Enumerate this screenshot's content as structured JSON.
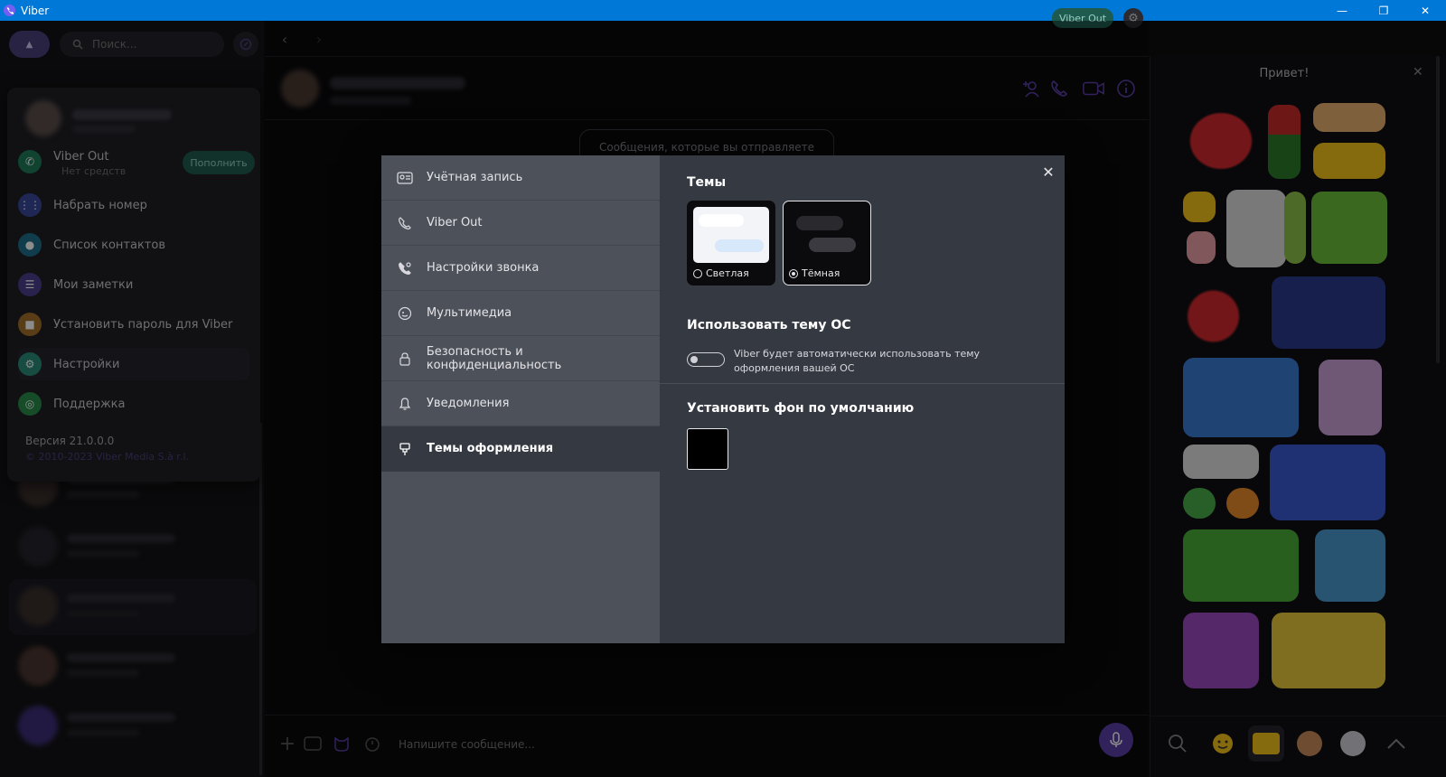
{
  "window": {
    "title": "Viber",
    "controls": [
      "—",
      "❐",
      "✕"
    ]
  },
  "left_panel": {
    "search": {
      "placeholder": "Поиск..."
    },
    "menu": {
      "viber_out": {
        "label": "Viber Out",
        "subtitle": "Нет средств",
        "topup_label": "Пополнить"
      },
      "items": [
        {
          "label": "Набрать номер",
          "icon": "dialpad-icon",
          "color": "#3a4a9a"
        },
        {
          "label": "Список контактов",
          "icon": "contacts-icon",
          "color": "#1f6e8a"
        },
        {
          "label": "Мои заметки",
          "icon": "notes-icon",
          "color": "#4a3f8a"
        },
        {
          "label": "Установить пароль для Viber",
          "icon": "lock-icon",
          "color": "#a0702a"
        },
        {
          "label": "Настройки",
          "icon": "gear-icon",
          "color": "#2a8a7a"
        },
        {
          "label": "Поддержка",
          "icon": "support-icon",
          "color": "#2a8a4a"
        }
      ],
      "version": "Версия 21.0.0.0",
      "copyright": "© 2010-2023 Viber Media S.à r.l."
    }
  },
  "top_bar": {
    "viber_out_label": "Viber Out"
  },
  "chat": {
    "encryption_notice": "Сообщения, которые вы отправляете",
    "composer_placeholder": "Напишите сообщение..."
  },
  "sticker_panel": {
    "greeting": "Привет!"
  },
  "settings_dialog": {
    "sidebar": [
      {
        "label": "Учётная запись",
        "icon": "account-card-icon",
        "active": false
      },
      {
        "label": "Viber Out",
        "icon": "phone-out-icon",
        "active": false
      },
      {
        "label": "Настройки звонка",
        "icon": "call-settings-icon",
        "active": false
      },
      {
        "label": "Мультимедиа",
        "icon": "media-icon",
        "active": false
      },
      {
        "label": "Безопасность и конфиденциальность",
        "icon": "lock-icon",
        "active": false
      },
      {
        "label": "Уведомления",
        "icon": "bell-icon",
        "active": false
      },
      {
        "label": "Темы оформления",
        "icon": "brush-icon",
        "active": true
      }
    ],
    "themes_heading": "Темы",
    "themes": [
      {
        "label": "Светлая",
        "selected": false
      },
      {
        "label": "Тёмная",
        "selected": true
      }
    ],
    "os_theme_heading": "Использовать тему ОС",
    "os_theme_description": "Viber будет автоматически использовать тему оформления вашей ОС",
    "os_theme_enabled": false,
    "default_bg_heading": "Установить фон по умолчанию",
    "default_bg_color": "#000000"
  },
  "colors": {
    "accent": "#5b3fa6",
    "titlebar": "#0078d7",
    "viber_out": "#1f5a4f"
  }
}
